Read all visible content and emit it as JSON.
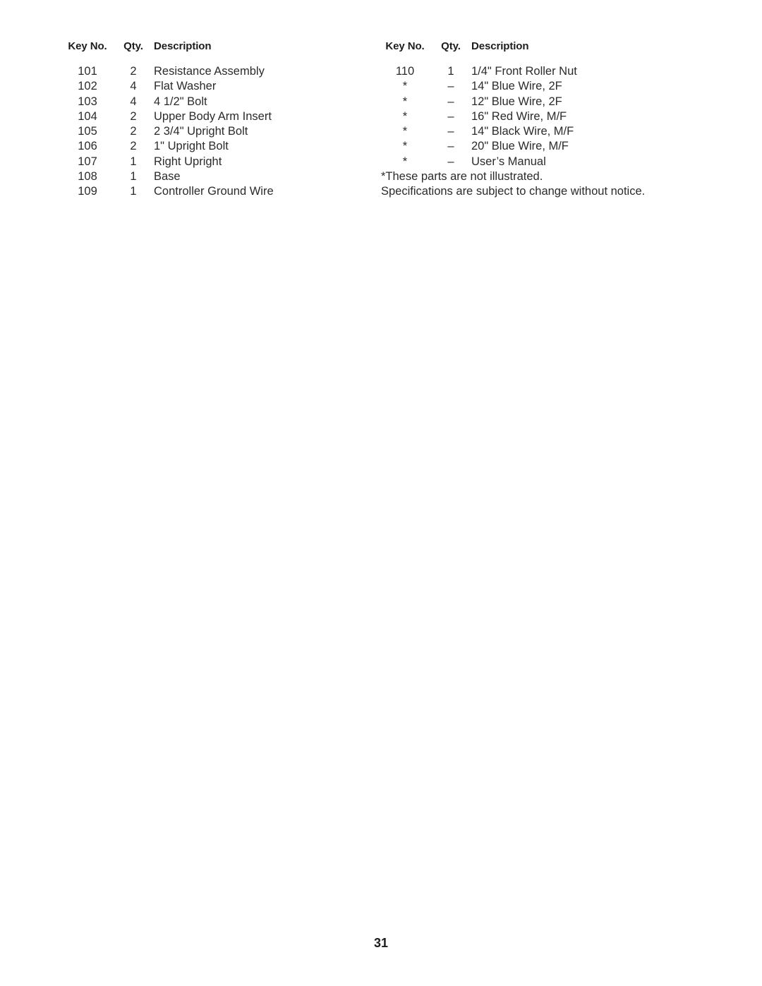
{
  "document": {
    "page_number": "31"
  },
  "columns": [
    {
      "id": "left",
      "headers": {
        "key_no": "Key No.",
        "qty": "Qty.",
        "description": "Description"
      },
      "rows": [
        {
          "key_no": "101",
          "qty": "2",
          "description": "Resistance Assembly"
        },
        {
          "key_no": "102",
          "qty": "4",
          "description": "Flat Washer"
        },
        {
          "key_no": "103",
          "qty": "4",
          "description": "4 1/2\" Bolt"
        },
        {
          "key_no": "104",
          "qty": "2",
          "description": "Upper Body Arm Insert"
        },
        {
          "key_no": "105",
          "qty": "2",
          "description": "2 3/4\" Upright Bolt"
        },
        {
          "key_no": "106",
          "qty": "2",
          "description": "1\" Upright Bolt"
        },
        {
          "key_no": "107",
          "qty": "1",
          "description": "Right Upright"
        },
        {
          "key_no": "108",
          "qty": "1",
          "description": "Base"
        },
        {
          "key_no": "109",
          "qty": "1",
          "description": "Controller Ground Wire"
        }
      ],
      "footnotes": []
    },
    {
      "id": "right",
      "headers": {
        "key_no": "Key No.",
        "qty": "Qty.",
        "description": "Description"
      },
      "rows": [
        {
          "key_no": "110",
          "qty": "1",
          "description": "1/4\" Front Roller Nut"
        },
        {
          "key_no": "*",
          "qty": "–",
          "description": "14\" Blue Wire, 2F"
        },
        {
          "key_no": "*",
          "qty": "–",
          "description": "12\" Blue Wire, 2F"
        },
        {
          "key_no": "*",
          "qty": "–",
          "description": "16\" Red Wire, M/F"
        },
        {
          "key_no": "*",
          "qty": "–",
          "description": "14\" Black Wire, M/F"
        },
        {
          "key_no": "*",
          "qty": "–",
          "description": "20\" Blue Wire, M/F"
        },
        {
          "key_no": "*",
          "qty": "–",
          "description": "User’s Manual"
        }
      ],
      "footnotes": [
        "*These parts are not illustrated.",
        "Specifications are subject to change without notice."
      ]
    }
  ]
}
